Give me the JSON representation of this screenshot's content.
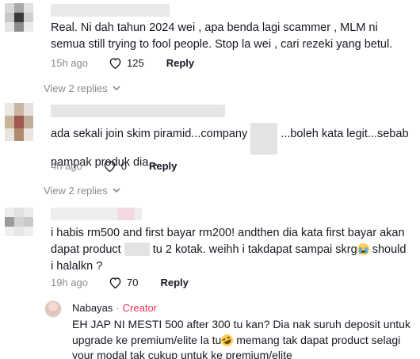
{
  "comments": [
    {
      "text": "Real. Ni dah tahun 2024 wei , apa benda lagi scammer , MLM ni semua still trying to fool people. Stop la wei , cari rezeki yang betul.",
      "time": "15h ago",
      "likes": "125",
      "reply_label": "Reply",
      "view_replies": "View 2 replies"
    },
    {
      "text_part1": "ada sekali join skim piramid...company",
      "text_part2": "...boleh kata legit...sebab nampak produk dia...",
      "time": "4h ago",
      "likes": "0",
      "reply_label": "Reply",
      "view_replies": "View 2 replies"
    },
    {
      "text_part1": "i habis rm500 and first bayar rm200! andthen dia kata first bayar akan dapat product",
      "text_part2": "tu 2 kotak. weihh i takdapat sampai skrg",
      "text_part3": "should i halalkn ?",
      "time": "19h ago",
      "likes": "70",
      "reply_label": "Reply"
    }
  ],
  "creator_reply": {
    "name": "Nabayas",
    "separator": "·",
    "badge": "Creator",
    "text_part1": "EH JAP NI MESTI 500 after 300 tu kan? Dia nak suruh deposit untuk upgrade ke premium/elite la tu",
    "text_part2": "memang tak dapat product selagi your modal tak cukup untuk ke premium/elite"
  },
  "icons": {
    "like": "heart-outline-icon",
    "expand": "chevron-down-icon",
    "emoji_crying": "crying-face-emoji",
    "emoji_laughing": "rolling-laughing-emoji"
  },
  "colors": {
    "text": "#161823",
    "secondary": "#8a8b91",
    "creator_badge": "#fe2c55"
  }
}
